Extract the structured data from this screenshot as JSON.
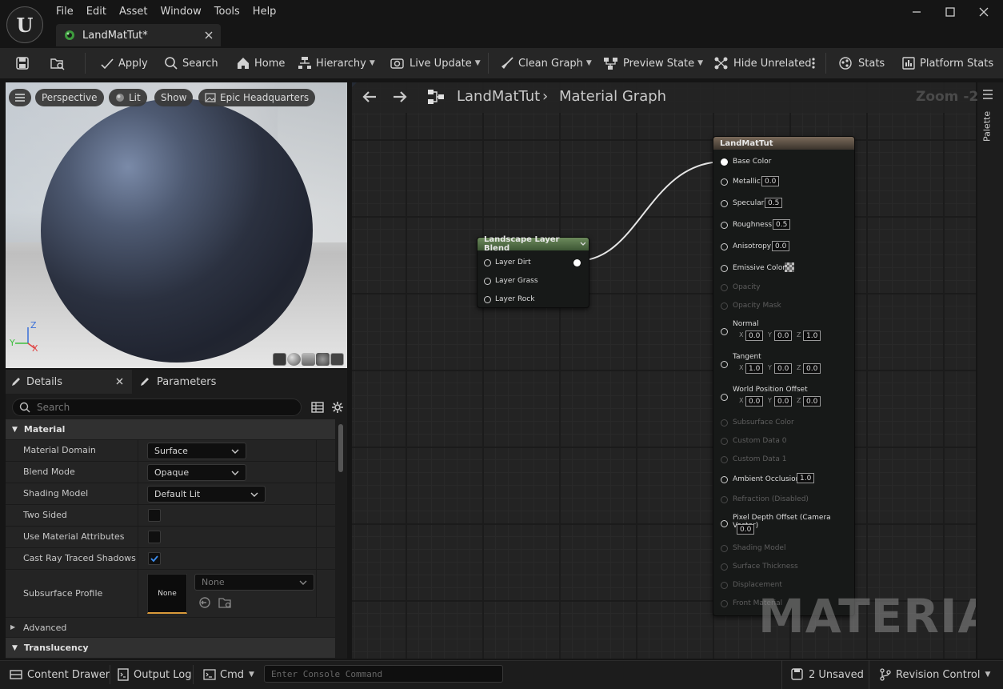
{
  "app": {
    "menu": [
      "File",
      "Edit",
      "Asset",
      "Window",
      "Tools",
      "Help"
    ],
    "tab_title": "LandMatTut*"
  },
  "toolbar": {
    "apply": "Apply",
    "search": "Search",
    "home": "Home",
    "hierarchy": "Hierarchy",
    "live_update": "Live Update",
    "clean_graph": "Clean Graph",
    "preview_state": "Preview State",
    "hide_unrelated": "Hide Unrelated",
    "stats": "Stats",
    "platform_stats": "Platform Stats"
  },
  "viewport": {
    "perspective": "Perspective",
    "lit": "Lit",
    "show": "Show",
    "environment": "Epic Headquarters",
    "axis_z": "Z",
    "axis_y": "Y",
    "axis_x": "X"
  },
  "details": {
    "tab_details": "Details",
    "tab_parameters": "Parameters",
    "search_placeholder": "Search",
    "cat_material": "Material",
    "props": [
      {
        "label": "Material Domain",
        "value": "Surface"
      },
      {
        "label": "Blend Mode",
        "value": "Opaque"
      },
      {
        "label": "Shading Model",
        "value": "Default Lit"
      },
      {
        "label": "Two Sided",
        "checked": false
      },
      {
        "label": "Use Material Attributes",
        "checked": false
      },
      {
        "label": "Cast Ray Traced Shadows",
        "checked": true
      }
    ],
    "subsurface_label": "Subsurface Profile",
    "subsurface_thumb": "None",
    "subsurface_value": "None",
    "cat_advanced": "Advanced",
    "cat_translucency": "Translucency"
  },
  "graph": {
    "breadcrumb_root": "LandMatTut",
    "breadcrumb_child": "Material Graph",
    "zoom": "Zoom -2",
    "watermark": "MATERIAL",
    "palette": "Palette",
    "blend_node": {
      "title": "Landscape Layer Blend",
      "pins": [
        "Layer Dirt",
        "Layer Grass",
        "Layer Rock"
      ]
    },
    "result_node": {
      "title": "LandMatTut",
      "base_color": "Base Color",
      "metallic": "Metallic",
      "metallic_val": "0.0",
      "specular": "Specular",
      "specular_val": "0.5",
      "roughness": "Roughness",
      "roughness_val": "0.5",
      "anisotropy": "Anisotropy",
      "anisotropy_val": "0.0",
      "emissive": "Emissive Color",
      "opacity": "Opacity",
      "opacity_mask": "Opacity Mask",
      "normal": "Normal",
      "normal_vals": [
        "0.0",
        "0.0",
        "1.0"
      ],
      "tangent": "Tangent",
      "tangent_vals": [
        "1.0",
        "0.0",
        "0.0"
      ],
      "wpo": "World Position Offset",
      "wpo_vals": [
        "0.0",
        "0.0",
        "0.0"
      ],
      "subsurface_color": "Subsurface Color",
      "custom0": "Custom Data 0",
      "custom1": "Custom Data 1",
      "ao": "Ambient Occlusion",
      "ao_val": "1.0",
      "refraction": "Refraction (Disabled)",
      "pdo": "Pixel Depth Offset (Camera Vector)",
      "pdo_val": "0.0",
      "shading_model": "Shading Model",
      "surface_thickness": "Surface Thickness",
      "displacement": "Displacement",
      "front_material": "Front Material",
      "ax_x": "X",
      "ax_y": "Y",
      "ax_z": "Z"
    }
  },
  "status": {
    "content_drawer": "Content Drawer",
    "output_log": "Output Log",
    "cmd": "Cmd",
    "console_placeholder": "Enter Console Command",
    "unsaved": "2 Unsaved",
    "revision": "Revision Control"
  }
}
